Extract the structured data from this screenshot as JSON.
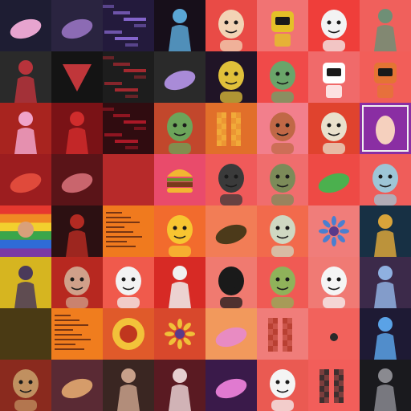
{
  "mosaic": {
    "columns": 8,
    "rows": 8,
    "tiles": [
      {
        "name": "tile-night-sky-pink-object",
        "bg": "#1e1d33",
        "fg": "#e7a4cf",
        "motif": "blob"
      },
      {
        "name": "tile-dark-flower-field",
        "bg": "#2a2440",
        "fg": "#8c6bb4",
        "motif": "blob"
      },
      {
        "name": "tile-purple-glitch-art",
        "bg": "#231a3c",
        "fg": "#8e6dd9",
        "motif": "glitch"
      },
      {
        "name": "tile-glowing-figure-dark",
        "bg": "#170f1a",
        "fg": "#5aa6d6",
        "motif": "figure"
      },
      {
        "name": "tile-woman-portrait-illustration",
        "bg": "#e94b46",
        "fg": "#f2d3b5",
        "motif": "face"
      },
      {
        "name": "tile-yellow-robot-character",
        "bg": "#f17373",
        "fg": "#e4c028",
        "motif": "robot"
      },
      {
        "name": "tile-santa-character",
        "bg": "#ef3e3a",
        "fg": "#f3f3f3",
        "motif": "face"
      },
      {
        "name": "tile-zombie-character",
        "bg": "#f0605c",
        "fg": "#6f8f76",
        "motif": "figure"
      },
      {
        "name": "tile-red-tribal-figure",
        "bg": "#2a2a2a",
        "fg": "#b8333b",
        "motif": "figure"
      },
      {
        "name": "tile-red-triangle-abstract",
        "bg": "#141414",
        "fg": "#c0363a",
        "motif": "triangle"
      },
      {
        "name": "tile-red-geometric-art",
        "bg": "#1d1d1d",
        "fg": "#b22a32",
        "motif": "glitch"
      },
      {
        "name": "tile-purple-shoe-object",
        "bg": "#2a2a2a",
        "fg": "#a98bd8",
        "motif": "blob"
      },
      {
        "name": "tile-yellow-demon-dog",
        "bg": "#201426",
        "fg": "#e0c03a",
        "motif": "face"
      },
      {
        "name": "tile-green-alien-sketch",
        "bg": "#f04a49",
        "fg": "#6aa56a",
        "motif": "face"
      },
      {
        "name": "tile-phone-character",
        "bg": "#f06a6a",
        "fg": "#ffffff",
        "motif": "robot"
      },
      {
        "name": "tile-astronaut-character",
        "bg": "#f25e59",
        "fg": "#e47434",
        "motif": "robot"
      },
      {
        "name": "tile-party-pinata",
        "bg": "#a8241f",
        "fg": "#f0a3c9",
        "motif": "figure"
      },
      {
        "name": "tile-red-devil-figure",
        "bg": "#7a1216",
        "fg": "#d02c2c",
        "motif": "figure"
      },
      {
        "name": "tile-red-pixel-glitch",
        "bg": "#300c10",
        "fg": "#b8192a",
        "motif": "glitch"
      },
      {
        "name": "tile-goblin-character",
        "bg": "#c2472c",
        "fg": "#6ca45a",
        "motif": "face"
      },
      {
        "name": "tile-pixel-sunglasses-face",
        "bg": "#e16f2a",
        "fg": "#f3b03b",
        "motif": "pixel"
      },
      {
        "name": "tile-cat-hoodie-character",
        "bg": "#f27f8c",
        "fg": "#c06846",
        "motif": "face"
      },
      {
        "name": "tile-fire-breathing-creature",
        "bg": "#e0432e",
        "fg": "#e9e0cc",
        "motif": "face"
      },
      {
        "name": "tile-cartoon-hand-frame",
        "bg": "#8a2ea3",
        "fg": "#f5d0be",
        "motif": "frame"
      },
      {
        "name": "tile-red-fish-creature",
        "bg": "#9c1d1f",
        "fg": "#e04a3b",
        "motif": "blob"
      },
      {
        "name": "tile-red-sky-landscape",
        "bg": "#5a1418",
        "fg": "#c9656d",
        "motif": "blob"
      },
      {
        "name": "tile-plain-red-gradient",
        "bg": "#b72a2a",
        "fg": "#c53a38",
        "motif": "none"
      },
      {
        "name": "tile-burger-kanji-art",
        "bg": "#e94b6b",
        "fg": "#f2b632",
        "motif": "burger"
      },
      {
        "name": "tile-hat-sunglasses-figure",
        "bg": "#f05a5a",
        "fg": "#3a3a3a",
        "motif": "face"
      },
      {
        "name": "tile-bubble-monster",
        "bg": "#f06d6d",
        "fg": "#7c8b59",
        "motif": "face"
      },
      {
        "name": "tile-green-sneaker",
        "bg": "#ee4a45",
        "fg": "#4bb04e",
        "motif": "blob"
      },
      {
        "name": "tile-raccoon-character",
        "bg": "#ef5d5a",
        "fg": "#9ec5d6",
        "motif": "face"
      },
      {
        "name": "tile-rainbow-flag-figure",
        "bg": "#e7382f",
        "fg": "#2f6bd6",
        "motif": "rainbow"
      },
      {
        "name": "tile-horned-red-figure",
        "bg": "#2c1012",
        "fg": "#b22a22",
        "motif": "figure"
      },
      {
        "name": "tile-orange-text-card",
        "bg": "#f07a1e",
        "fg": "#5a2410",
        "motif": "lines"
      },
      {
        "name": "tile-sunflower-sunglasses-face",
        "bg": "#f26b2d",
        "fg": "#f7c531",
        "motif": "face"
      },
      {
        "name": "tile-crowned-creature",
        "bg": "#f27d56",
        "fg": "#4c3a1a",
        "motif": "blob"
      },
      {
        "name": "tile-pale-figure-hat",
        "bg": "#f26a4c",
        "fg": "#cfd8c2",
        "motif": "face"
      },
      {
        "name": "tile-green-star-flower",
        "bg": "#f07d7a",
        "fg": "#4a7fd0",
        "motif": "star"
      },
      {
        "name": "tile-egyptian-figure",
        "bg": "#173044",
        "fg": "#d9a43a",
        "motif": "figure"
      },
      {
        "name": "tile-robot-spider-yellow",
        "bg": "#d6b520",
        "fg": "#4a3a5a",
        "motif": "figure"
      },
      {
        "name": "tile-man-portrait-photo",
        "bg": "#b72820",
        "fg": "#d0a08a",
        "motif": "face"
      },
      {
        "name": "tile-skull-cat-character",
        "bg": "#f05a4c",
        "fg": "#f2f2f2",
        "motif": "face"
      },
      {
        "name": "tile-man-red-suit",
        "bg": "#d72a25",
        "fg": "#f0f0f0",
        "motif": "figure"
      },
      {
        "name": "tile-penguin-character",
        "bg": "#f07a70",
        "fg": "#1a1a1a",
        "motif": "face"
      },
      {
        "name": "tile-green-alien-pointing",
        "bg": "#f05a54",
        "fg": "#8fb25a",
        "motif": "face"
      },
      {
        "name": "tile-kitsune-mask",
        "bg": "#f07a74",
        "fg": "#f5f5f5",
        "motif": "face"
      },
      {
        "name": "tile-ghostly-blue-figure",
        "bg": "#3c2a4a",
        "fg": "#8fb0e0",
        "motif": "figure"
      },
      {
        "name": "tile-dark-gold-gradient",
        "bg": "#4a3a14",
        "fg": "#6a5420",
        "motif": "none"
      },
      {
        "name": "tile-orange-text-list",
        "bg": "#f07d1e",
        "fg": "#5a2410",
        "motif": "lines"
      },
      {
        "name": "tile-sun-face-emblem",
        "bg": "#e05a2a",
        "fg": "#f2c23a",
        "motif": "sun"
      },
      {
        "name": "tile-golden-flower-cluster",
        "bg": "#d8482c",
        "fg": "#f0c039",
        "motif": "star"
      },
      {
        "name": "tile-pink-duck-figure",
        "bg": "#f2995c",
        "fg": "#e88bc2",
        "motif": "blob"
      },
      {
        "name": "tile-pixel-rainbow-figure",
        "bg": "#f07d7a",
        "fg": "#b23a2a",
        "motif": "pixel"
      },
      {
        "name": "tile-tiny-character-red",
        "bg": "#f2625c",
        "fg": "#2a2a2a",
        "motif": "dot"
      },
      {
        "name": "tile-blue-lightning-figure",
        "bg": "#1e1a34",
        "fg": "#5aa2e6",
        "motif": "figure"
      },
      {
        "name": "tile-cowboy-portrait",
        "bg": "#8a2a1e",
        "fg": "#c09060",
        "motif": "face"
      },
      {
        "name": "tile-sunset-river-photo",
        "bg": "#5a2a34",
        "fg": "#d59c6a",
        "motif": "blob"
      },
      {
        "name": "tile-two-men-photo",
        "bg": "#3a2622",
        "fg": "#c8a08a",
        "motif": "figure"
      },
      {
        "name": "tile-girl-figure-photo",
        "bg": "#5a1a22",
        "fg": "#e6cfd0",
        "motif": "figure"
      },
      {
        "name": "tile-pink-sparkle-figure",
        "bg": "#3a1a4a",
        "fg": "#e07ad0",
        "motif": "blob"
      },
      {
        "name": "tile-penguin-horns-character",
        "bg": "#ea5a52",
        "fg": "#f4f4f4",
        "motif": "face"
      },
      {
        "name": "tile-pixel-suit-man",
        "bg": "#f25e5a",
        "fg": "#2a2a2a",
        "motif": "pixel"
      },
      {
        "name": "tile-dark-photo-figure",
        "bg": "#1a1a1e",
        "fg": "#8a8a90",
        "motif": "figure"
      }
    ]
  }
}
